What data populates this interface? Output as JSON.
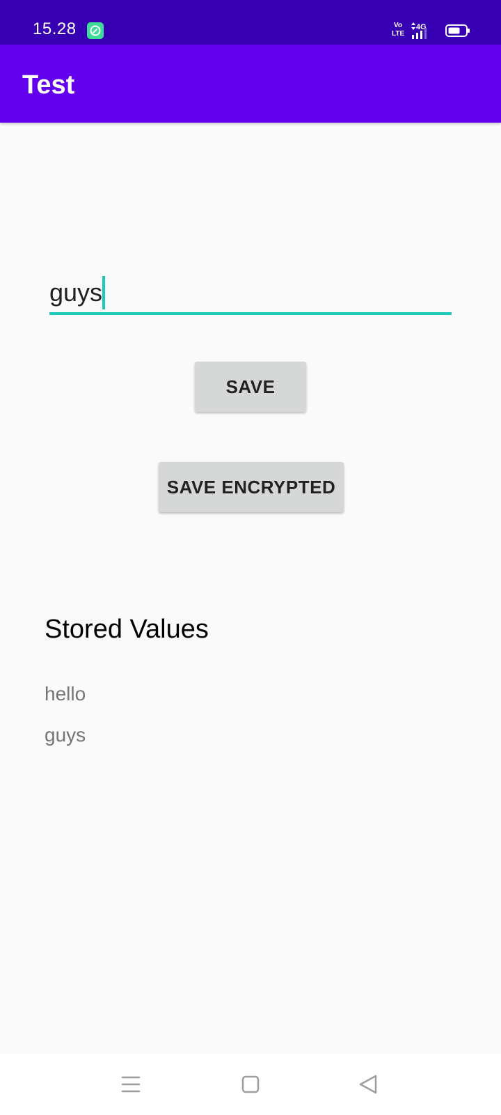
{
  "status_bar": {
    "time": "15.28",
    "volte_top": "Vo",
    "volte_bottom": "LTE",
    "network": "4G",
    "app_icon": "app-notification-icon",
    "battery_icon": "battery-icon",
    "signal_icon": "signal-icon"
  },
  "app_bar": {
    "title": "Test",
    "color": "#6200ee",
    "status_color": "#3700b3"
  },
  "form": {
    "input_value": "guys",
    "accent_color": "#1ec8b8",
    "save_label": "SAVE",
    "save_encrypted_label": "SAVE ENCRYPTED"
  },
  "stored": {
    "heading": "Stored Values",
    "items": [
      "hello",
      "guys"
    ]
  },
  "nav_bar": {
    "menu_icon": "menu-icon",
    "home_icon": "home-icon",
    "back_icon": "back-icon"
  }
}
